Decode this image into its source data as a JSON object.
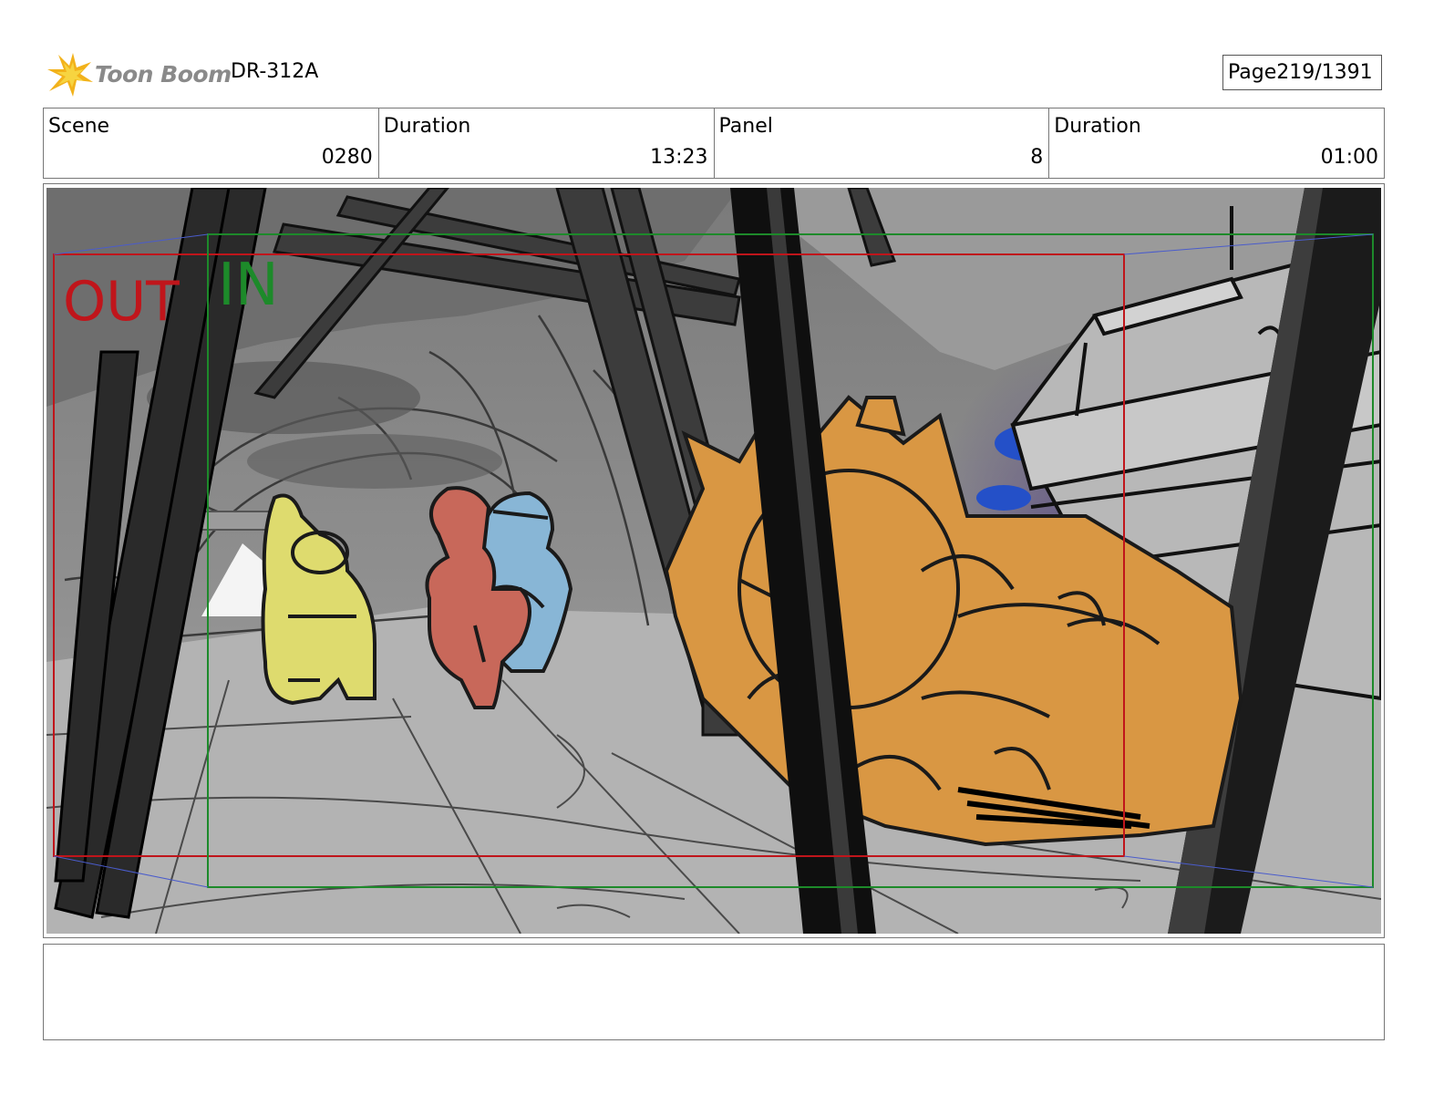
{
  "header": {
    "logo_text": "Toon Boom",
    "doc_id": "DR-312A",
    "page_label": "Page",
    "page_value": "219/1391"
  },
  "info": {
    "scene_label": "Scene",
    "scene_value": "0280",
    "scene_duration_label": "Duration",
    "scene_duration_value": "13:23",
    "panel_label": "Panel",
    "panel_value": "8",
    "panel_duration_label": "Duration",
    "panel_duration_value": "01:00"
  },
  "panel": {
    "out_marker": "OUT",
    "in_marker": "IN",
    "colors": {
      "out_frame": "#c0151b",
      "in_frame": "#1d8a2a",
      "yellow_character": "#dedb6e",
      "red_character": "#c8685a",
      "blue_character": "#88b6d6",
      "orange_character": "#d99743",
      "background_gray": "#8e8e8e"
    }
  },
  "notes": {
    "text": ""
  }
}
